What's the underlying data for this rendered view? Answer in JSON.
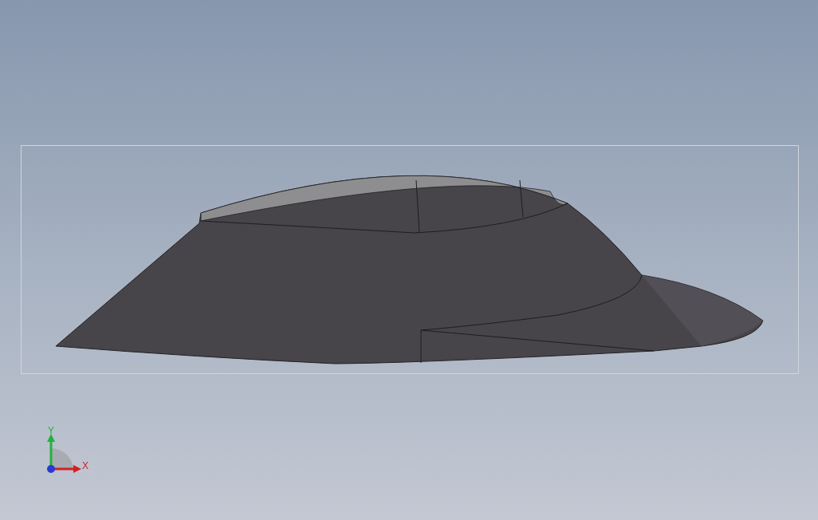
{
  "viewport": {
    "axis_triad": {
      "y_label": "Y",
      "x_label": "X"
    }
  }
}
